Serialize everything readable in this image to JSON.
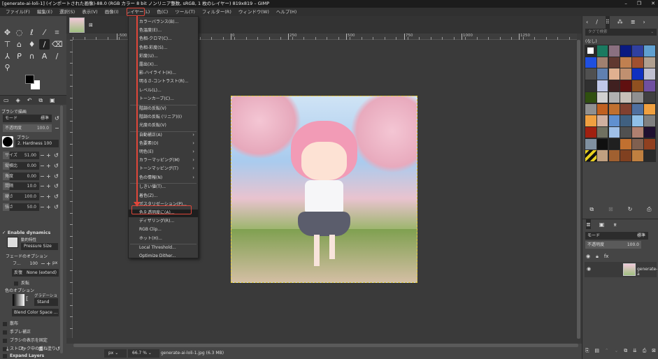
{
  "window": {
    "title": "[generate-ai-loli-1] (インポートされた画像)-88.0 (RGB カラー 8 bit ノンリニア整数, sRGB, 1 枚のレイヤー) 819x819 – GIMP",
    "controls": [
      "–",
      "❐",
      "✕"
    ]
  },
  "menubar": [
    "ファイル(F)",
    "編集(E)",
    "選択(S)",
    "表示(V)",
    "画像(I)",
    "レイヤー(L)",
    "色(C)",
    "ツール(T)",
    "フィルター(R)",
    "ウィンドウ(W)",
    "ヘルプ(H)"
  ],
  "color_menu": {
    "items": [
      {
        "label": "カラーバランス(B)...",
        "sub": false
      },
      {
        "label": "色温度(E)...",
        "sub": false
      },
      {
        "label": "色相-クロマ(C)...",
        "sub": false
      },
      {
        "label": "色相-彩度(S)...",
        "sub": false
      },
      {
        "label": "彩度(U)...",
        "sub": false
      },
      {
        "label": "露出(X)...",
        "sub": false
      },
      {
        "label": "影-ハイライト(H)...",
        "sub": false
      },
      {
        "label": "明るさ-コントラスト(R)...",
        "sub": false
      },
      {
        "label": "レベル(L)...",
        "sub": false
      },
      {
        "label": "トーンカーブ(C)...",
        "sub": false,
        "sep_after": true
      },
      {
        "label": "階調の反転(V)",
        "sub": false
      },
      {
        "label": "階調の反転 (リニア)(I)",
        "sub": false
      },
      {
        "label": "光度の反転(V)",
        "sub": false,
        "sep_after": true
      },
      {
        "label": "自動補正(A)",
        "sub": true
      },
      {
        "label": "色要素(O)",
        "sub": true
      },
      {
        "label": "明色(E)",
        "sub": true
      },
      {
        "label": "カラーマッピング(M)",
        "sub": true
      },
      {
        "label": "トーンマッピング(T)",
        "sub": true
      },
      {
        "label": "色の情報(N)",
        "sub": true,
        "sep_after": true
      },
      {
        "label": "しきい値(T)...",
        "sub": false
      },
      {
        "label": "着色(Z)...",
        "sub": false
      },
      {
        "label": "ポスタリゼーション(P)...",
        "sub": false
      },
      {
        "label": "色を透明度に(A)...",
        "sub": false,
        "highlighted": true
      },
      {
        "label": "ディザリング(R)...",
        "sub": false
      },
      {
        "label": "RGB Clip...",
        "sub": false
      },
      {
        "label": "ホット(H)...",
        "sub": false,
        "sep_after": true
      },
      {
        "label": "Local Threshold...",
        "sub": false
      },
      {
        "label": "Optimize Dither...",
        "sub": false
      }
    ]
  },
  "tool_options": {
    "title": "ブラシで描画",
    "mode_label": "モード",
    "mode_value": "標準",
    "opacity_label": "不透明度",
    "opacity_value": "100.0",
    "brush_label": "ブラシ",
    "brush_value": "2. Hardness 100",
    "sliders": [
      {
        "label": "サイズ",
        "value": "51.00"
      },
      {
        "label": "縦横比",
        "value": "0.00"
      },
      {
        "label": "角度",
        "value": "0.00"
      },
      {
        "label": "間隔",
        "value": "10.0"
      },
      {
        "label": "硬さ",
        "value": "100.0"
      },
      {
        "label": "強さ",
        "value": "50.0"
      }
    ],
    "enable_dynamics": "Enable dynamics",
    "dynamics_label": "動的特性",
    "dynamics_value": "Pressure Size",
    "fade_title": "フェードのオプション",
    "fade_length_label": "フ...",
    "fade_length_value": "100",
    "fade_unit": "px",
    "repeat_label": "反復",
    "repeat_value": "None (extend)",
    "reverse_label": "反転",
    "color_title": "色のオプション",
    "gradient_label": "グラデーショ",
    "gradient_value": "Stand",
    "blend_space": "Blend Color Space ...",
    "checks": [
      "散布",
      "手ブレ補正",
      "ブラシの表示を固定",
      "ストローク中の重ね塗り",
      "Expand Layers"
    ]
  },
  "rulers": {
    "h": [
      "-500",
      "0",
      "250",
      "500",
      "750",
      "1000",
      "1250"
    ]
  },
  "status": {
    "unit": "px",
    "zoom": "66.7 %",
    "file": "generate-ai-loli-1.jpg (6.3 MB)"
  },
  "right": {
    "tag_placeholder": "タグで検索",
    "pattern_group": "(なし)",
    "patterns": [
      "#ffffff",
      "#1a7a60",
      "#8a7080",
      "#0a1a80",
      "#3040a0",
      "#60a0d0",
      "#2050e0",
      "#a08070",
      "#603830",
      "#c08050",
      "#a05030",
      "#b0a090",
      "#505050",
      "#6080b0",
      "#e0b090",
      "#c09070",
      "#1030c0",
      "#c0c0d0",
      "#303030",
      "#c0c8e8",
      "#402020",
      "#601010",
      "#905020",
      "#7050a0",
      "#305010",
      "#d0d0d0",
      "#b0b0b0",
      "#c8c0b8",
      "#909090",
      "#404040",
      "#909090",
      "#c06020",
      "#c07030",
      "#804030",
      "#5070a0",
      "#f0a040",
      "#f0a040",
      "#d0b0a0",
      "#6090d0",
      "#406080",
      "#90c0e8",
      "#808080",
      "#a02010",
      "#707060",
      "#a0c0e8",
      "#505050",
      "#b08070",
      "#201030",
      "#8090a0",
      "#101010",
      "#202020",
      "#c07030",
      "#806050",
      "#904020",
      "#e8d020",
      "#c0a080",
      "#a06030",
      "#804020",
      "#c08040"
    ],
    "layers_mode_label": "モード",
    "layers_mode_value": "標準",
    "layers_opacity_label": "不透明度",
    "layers_opacity_value": "100.0",
    "layer_name": "generate-a"
  },
  "colors": {
    "highlight": "#e0463a",
    "bg": "#454545"
  }
}
